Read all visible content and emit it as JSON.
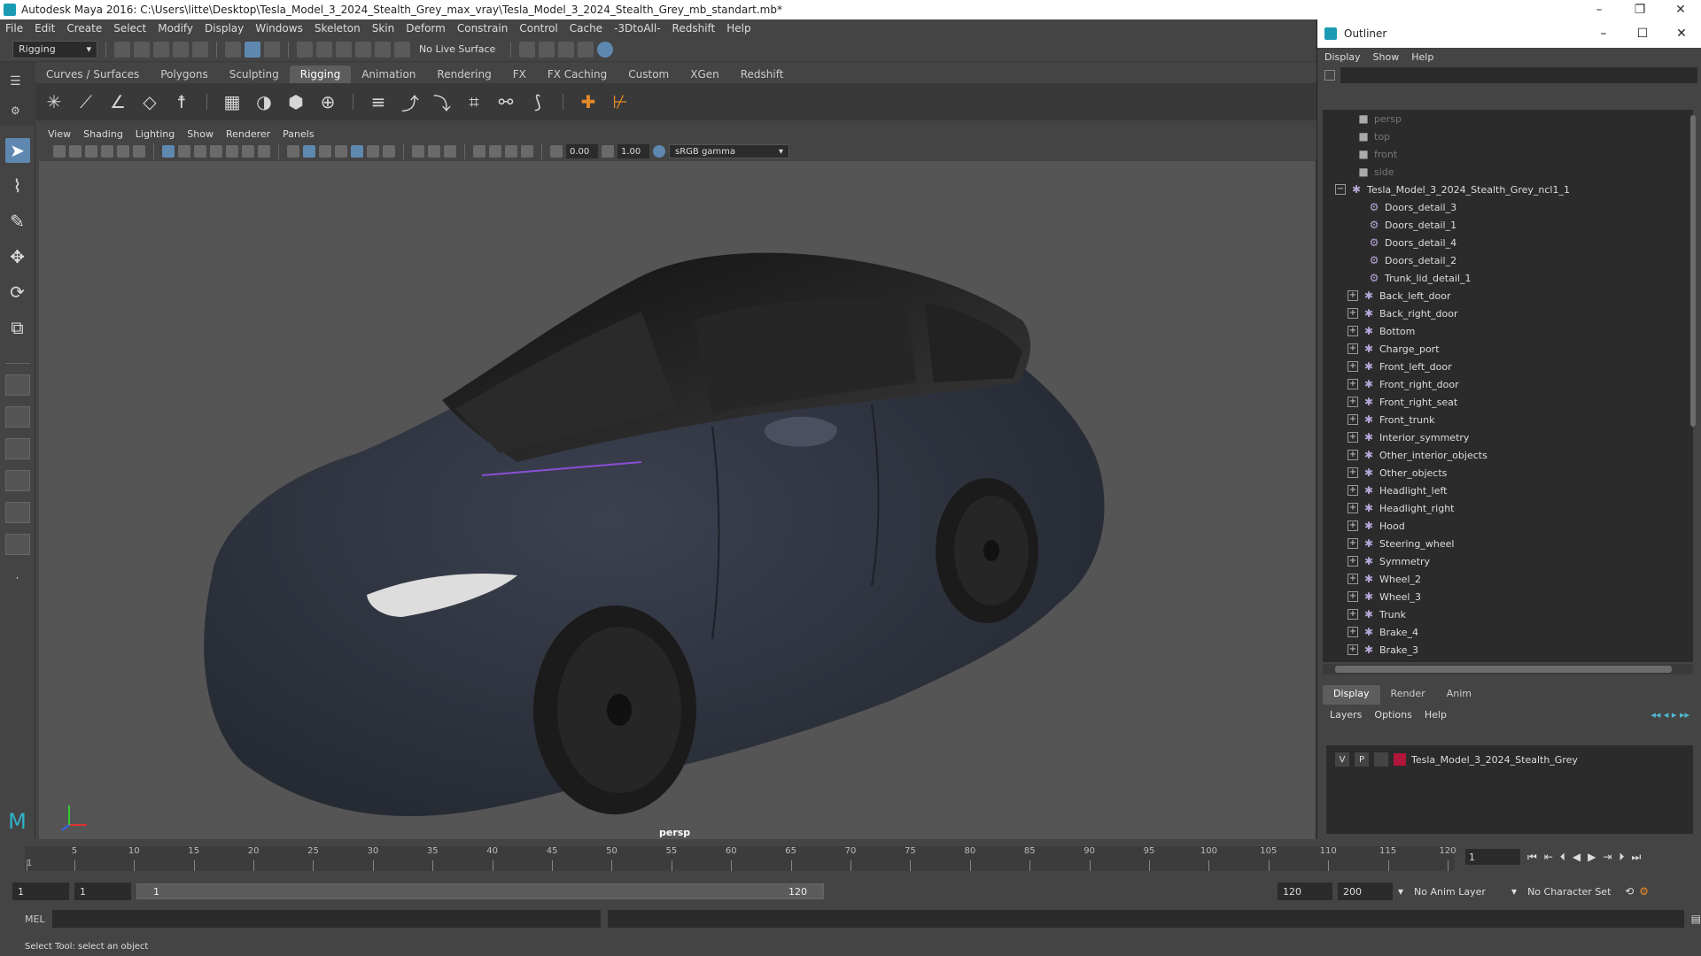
{
  "window": {
    "title": "Autodesk Maya 2016: C:\\Users\\litte\\Desktop\\Tesla_Model_3_2024_Stealth_Grey_max_vray\\Tesla_Model_3_2024_Stealth_Grey_mb_standart.mb*",
    "controls": [
      "–",
      "❐",
      "✕"
    ]
  },
  "menubar": [
    "File",
    "Edit",
    "Create",
    "Select",
    "Modify",
    "Display",
    "Windows",
    "Skeleton",
    "Skin",
    "Deform",
    "Constrain",
    "Control",
    "Cache",
    "-3DtoAll-",
    "Redshift",
    "Help"
  ],
  "statusline": {
    "mode": "Rigging",
    "live_surface": "No Live Surface"
  },
  "shelf": {
    "tabs": [
      "Curves / Surfaces",
      "Polygons",
      "Sculpting",
      "Rigging",
      "Animation",
      "Rendering",
      "FX",
      "FX Caching",
      "Custom",
      "XGen",
      "Redshift"
    ],
    "active_tab": "Rigging"
  },
  "panel": {
    "menu": [
      "View",
      "Shading",
      "Lighting",
      "Show",
      "Renderer",
      "Panels"
    ],
    "near_value": "0.00",
    "far_value": "1.00",
    "color_space": "sRGB gamma",
    "camera_label": "persp"
  },
  "timeline": {
    "ticks": [
      1,
      5,
      10,
      15,
      20,
      25,
      30,
      35,
      40,
      45,
      50,
      55,
      60,
      65,
      70,
      75,
      80,
      85,
      90,
      95,
      100,
      105,
      110,
      115,
      120
    ],
    "current_frame": "1",
    "max_frame": 120
  },
  "range": {
    "start": "1",
    "start2": "1",
    "slider_start": "1",
    "slider_end": "120",
    "end": "120",
    "end2": "200",
    "anim_layer": "No Anim Layer",
    "char_set": "No Character Set"
  },
  "cmdline": {
    "label": "MEL"
  },
  "helpline": "Select Tool: select an object",
  "outliner": {
    "title": "Outliner",
    "menu": [
      "Display",
      "Show",
      "Help"
    ],
    "cameras": [
      "persp",
      "top",
      "front",
      "side"
    ],
    "root": "Tesla_Model_3_2024_Stealth_Grey_ncl1_1",
    "children_leaf": [
      "Doors_detail_3",
      "Doors_detail_1",
      "Doors_detail_4",
      "Doors_detail_2",
      "Trunk_lid_detail_1"
    ],
    "children_group": [
      "Back_left_door",
      "Back_right_door",
      "Bottom",
      "Charge_port",
      "Front_left_door",
      "Front_right_door",
      "Front_right_seat",
      "Front_trunk",
      "Interior_symmetry",
      "Other_interior_objects",
      "Other_objects",
      "Headlight_left",
      "Headlight_right",
      "Hood",
      "Steering_wheel",
      "Symmetry",
      "Wheel_2",
      "Wheel_3",
      "Trunk",
      "Brake_4",
      "Brake_3"
    ]
  },
  "layer_editor": {
    "tabs": [
      "Display",
      "Render",
      "Anim"
    ],
    "active_tab": "Display",
    "menu": [
      "Layers",
      "Options",
      "Help"
    ],
    "layer": {
      "v": "V",
      "p": "P",
      "name": "Tesla_Model_3_2024_Stealth_Grey",
      "color": "#b0163a"
    }
  }
}
